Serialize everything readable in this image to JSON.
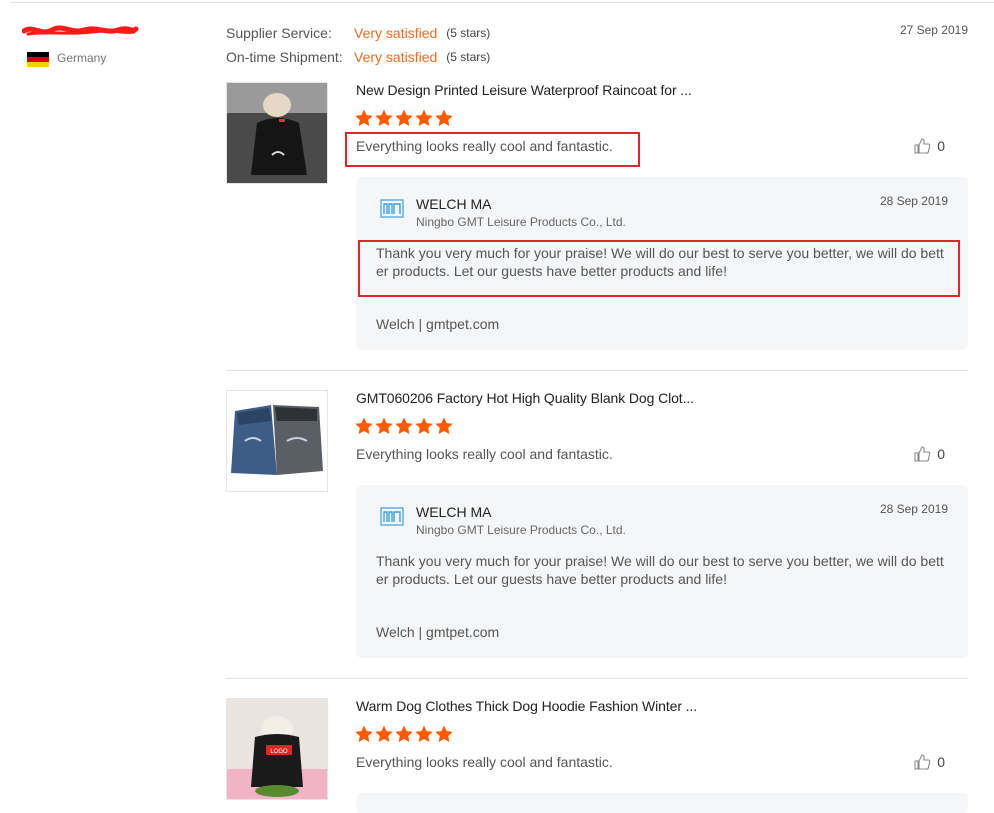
{
  "reviewer": {
    "name_masked": "**************",
    "country": "Germany",
    "flag_colors": [
      "#000000",
      "#dd0000",
      "#ffce00"
    ]
  },
  "ratings": {
    "supplier_service_label": "Supplier Service:",
    "supplier_service_value": "Very satisfied",
    "supplier_service_stars": "(5 stars)",
    "shipment_label": "On-time Shipment:",
    "shipment_value": "Very satisfied",
    "shipment_stars": "(5 stars)"
  },
  "review_date": "27 Sep 2019",
  "colors": {
    "accent": "#f26a1b",
    "star": "#ff5a00",
    "highlight": "#e3242b",
    "reply_bg": "#f5f6f8"
  },
  "products": [
    {
      "title": "New Design Printed Leisure Waterproof Raincoat for ...",
      "rating": 5,
      "review_text": "Everything looks really cool and fantastic.",
      "likes": "0",
      "thumb_icon": "black-dog-raincoat-photo",
      "reply": {
        "name": "WELCH MA",
        "company": "Ningbo GMT Leisure Products Co., Ltd.",
        "date": "28 Sep 2019",
        "body": "Thank you very much for your praise! We will do our best to serve you better, we will do better products. Let our guests have better products and life!",
        "signature": "Welch | gmtpet.com"
      }
    },
    {
      "title": "GMT060206 Factory Hot High Quality Blank Dog Clot...",
      "rating": 5,
      "review_text": "Everything looks really cool and fantastic.",
      "likes": "0",
      "thumb_icon": "denim-dog-vest-photo",
      "reply": {
        "name": "WELCH MA",
        "company": "Ningbo GMT Leisure Products Co., Ltd.",
        "date": "28 Sep 2019",
        "body": "Thank you very much for your praise! We will do our best to serve you better, we will do better products. Let our guests have better products and life!",
        "signature": "Welch | gmtpet.com"
      }
    },
    {
      "title": "Warm Dog Clothes Thick Dog Hoodie Fashion Winter ...",
      "rating": 5,
      "review_text": "Everything looks really cool and fantastic.",
      "likes": "0",
      "thumb_icon": "dog-hoodie-photo",
      "thumb_label": "LOGO"
    }
  ]
}
